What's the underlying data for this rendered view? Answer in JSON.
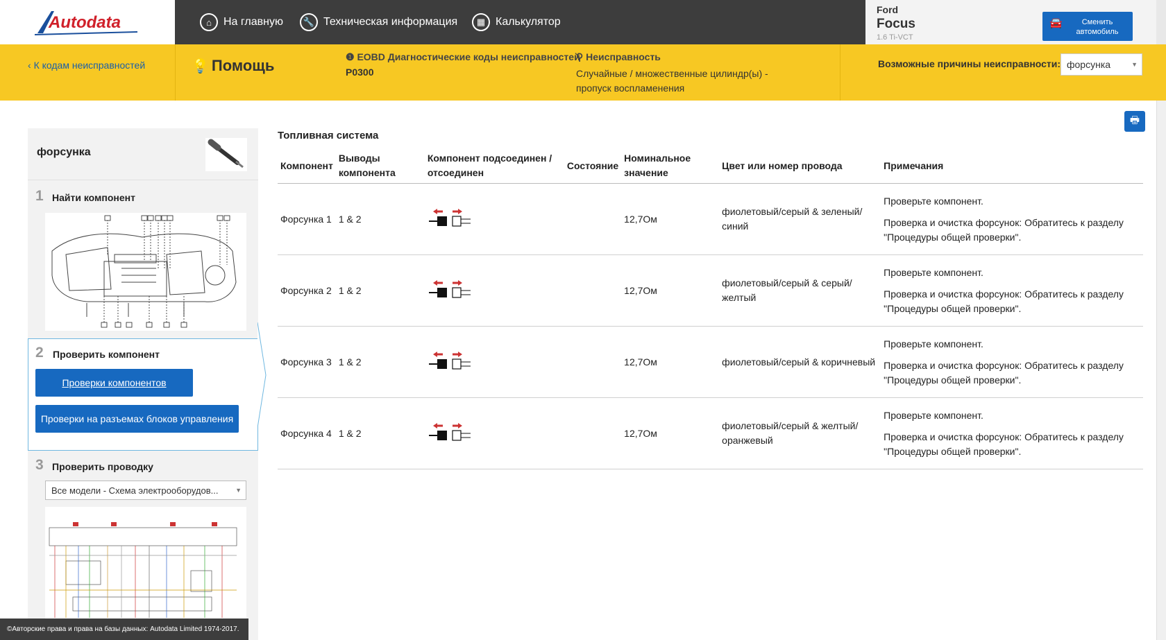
{
  "header": {
    "logo_text": "Autodata",
    "nav": [
      {
        "label": "На главную",
        "icon": "home-icon"
      },
      {
        "label": "Техническая информация",
        "icon": "wrench-icon"
      },
      {
        "label": "Калькулятор",
        "icon": "calculator-icon"
      }
    ],
    "vehicle": {
      "make": "Ford",
      "model": "Focus",
      "engine": "1.6 Ti-VCT"
    },
    "change_vehicle_label": "Сменить автомобиль"
  },
  "subheader": {
    "back_label": "К кодам неисправностей",
    "help_label": "Помощь",
    "eobd_heading": "EOBD Диагностические коды неисправностей",
    "eobd_code": "P0300",
    "fault_heading": "Неисправность",
    "fault_text": "Случайные / множественные цилиндр(ы) - пропуск воспламенения",
    "causes_label": "Возможные причины неисправности:",
    "causes_value": "форсунка"
  },
  "left_panel": {
    "component_name": "форсунка",
    "step1": {
      "num": "1",
      "title": "Найти компонент"
    },
    "step2": {
      "num": "2",
      "title": "Проверить компонент",
      "btn_components": "Проверки компонентов",
      "btn_ecu": "Проверки на разъемах блоков управления"
    },
    "step3": {
      "num": "3",
      "title": "Проверить проводку",
      "select_value": "Все модели - Схема электрооборудов..."
    }
  },
  "main": {
    "section_title": "Топливная система",
    "columns": [
      "Компонент",
      "Выводы компонента",
      "Компонент подсоединен / отсоединен",
      "Состояние",
      "Номинальное значение",
      "Цвет или номер провода",
      "Примечания"
    ],
    "rows": [
      {
        "component": "Форсунка 1",
        "pins": "1 & 2",
        "state": "",
        "value": "12,7Ом",
        "wire": "фиолетовый/серый & зеленый/синий",
        "note1": "Проверьте компонент.",
        "note2": "Проверка и очистка форсунок: Обратитесь к разделу \"Процедуры общей проверки\"."
      },
      {
        "component": "Форсунка 2",
        "pins": "1 & 2",
        "state": "",
        "value": "12,7Ом",
        "wire": "фиолетовый/серый & серый/желтый",
        "note1": "Проверьте компонент.",
        "note2": "Проверка и очистка форсунок: Обратитесь к разделу \"Процедуры общей проверки\"."
      },
      {
        "component": "Форсунка 3",
        "pins": "1 & 2",
        "state": "",
        "value": "12,7Ом",
        "wire": "фиолетовый/серый & коричневый",
        "note1": "Проверьте компонент.",
        "note2": "Проверка и очистка форсунок: Обратитесь к разделу \"Процедуры общей проверки\"."
      },
      {
        "component": "Форсунка 4",
        "pins": "1 & 2",
        "state": "",
        "value": "12,7Ом",
        "wire": "фиолетовый/серый & желтый/оранжевый",
        "note1": "Проверьте компонент.",
        "note2": "Проверка и очистка форсунок: Обратитесь к разделу \"Процедуры общей проверки\"."
      }
    ]
  },
  "footer": {
    "copyright": "©Авторские права и права на базы данных: Autodata Limited 1974-2017."
  },
  "colors": {
    "accent_blue": "#1769c0",
    "header_dark": "#3d3d3d",
    "yellow": "#f7c823",
    "logo_red": "#d0202a"
  }
}
